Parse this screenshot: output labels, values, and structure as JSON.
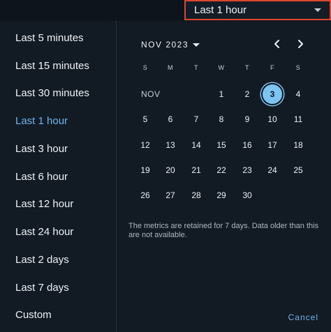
{
  "header": {
    "selected_range": "Last 1 hour"
  },
  "sidebar": {
    "items": [
      {
        "label": "Last 5 minutes"
      },
      {
        "label": "Last 15 minutes"
      },
      {
        "label": "Last 30 minutes"
      },
      {
        "label": "Last 1 hour",
        "active": true
      },
      {
        "label": "Last 3 hour"
      },
      {
        "label": "Last 6 hour"
      },
      {
        "label": "Last 12 hour"
      },
      {
        "label": "Last 24 hour"
      },
      {
        "label": "Last 2 days"
      },
      {
        "label": "Last 7 days"
      },
      {
        "label": "Custom"
      }
    ]
  },
  "calendar": {
    "month_year": "NOV 2023",
    "weekdays": [
      "S",
      "M",
      "T",
      "W",
      "T",
      "F",
      "S"
    ],
    "month_label": "NOV",
    "first_weekday_index": 3,
    "days_in_month": 30,
    "selected_day": 3,
    "prev_icon": "chevron-left-icon",
    "next_icon": "chevron-right-icon",
    "note": "The metrics are retained for 7 days. Data older than this are not available.",
    "cancel_label": "Cancel"
  },
  "colors": {
    "accent": "#6fb4ee",
    "selected_day_bg": "#7ec4f2",
    "highlight_border": "#e0462f"
  }
}
